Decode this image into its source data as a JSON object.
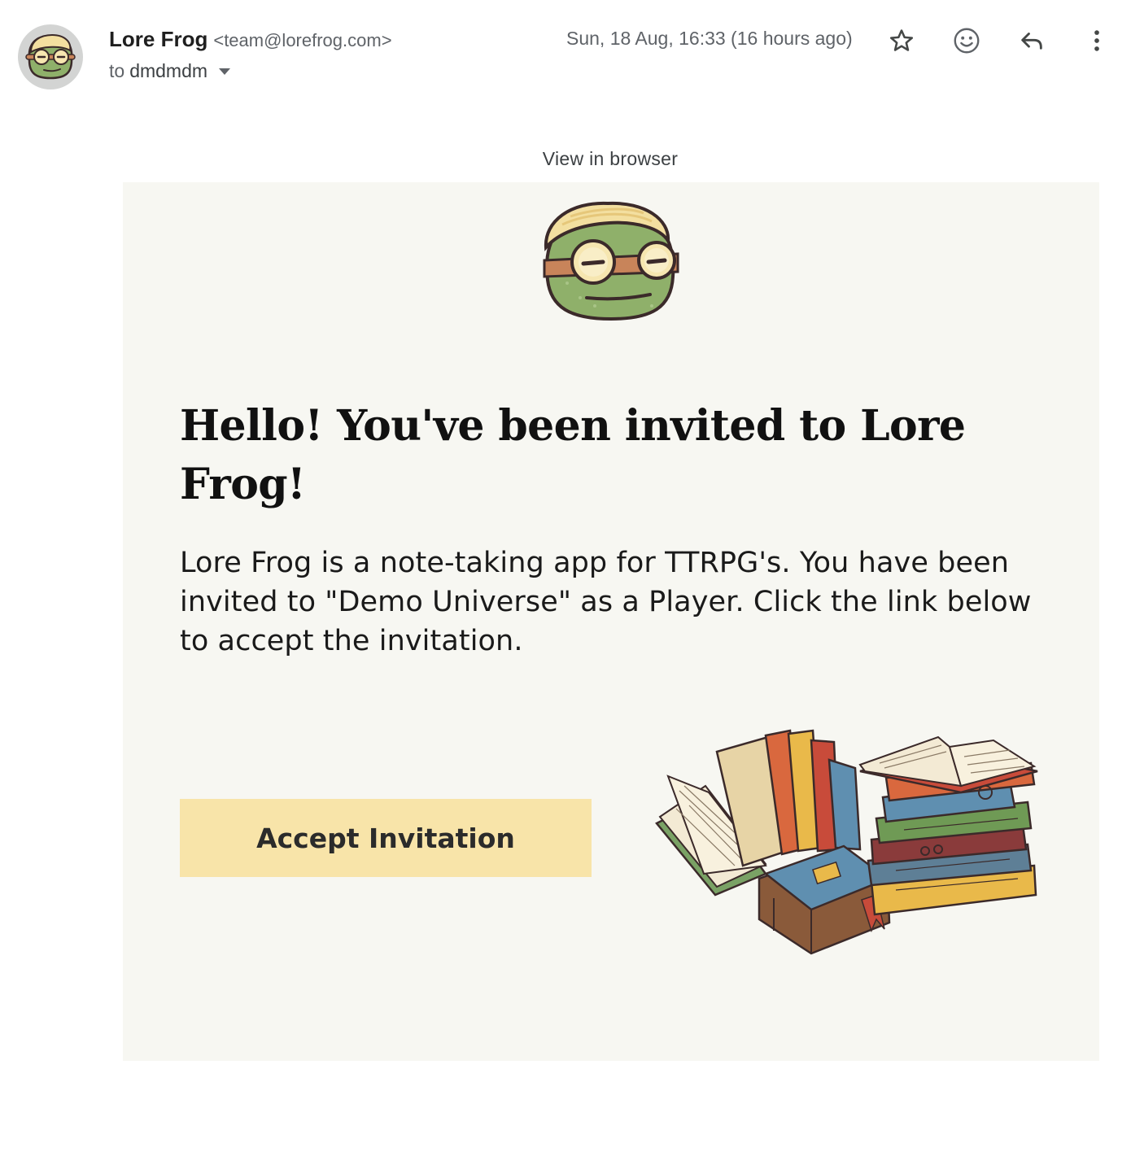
{
  "header": {
    "sender_name": "Lore Frog",
    "sender_email": "<team@lorefrog.com>",
    "to_prefix": "to",
    "recipient": "dmdmdm",
    "timestamp": "Sun, 18 Aug, 16:33 (16 hours ago)",
    "icons": [
      "star-icon",
      "emoji-reaction-icon",
      "reply-icon",
      "more-vert-icon"
    ]
  },
  "email": {
    "view_in_browser": "View in browser",
    "headline": "Hello! You've been invited to Lore Frog!",
    "body": "Lore Frog is a note-taking app for TTRPG's. You have been invited to \"Demo Universe\" as a Player. Click the link below to accept the invitation.",
    "cta_label": "Accept Invitation"
  },
  "colors": {
    "card_background": "#f7f7f2",
    "cta_background": "#f8e4a9",
    "frog_green": "#8fb06a"
  }
}
